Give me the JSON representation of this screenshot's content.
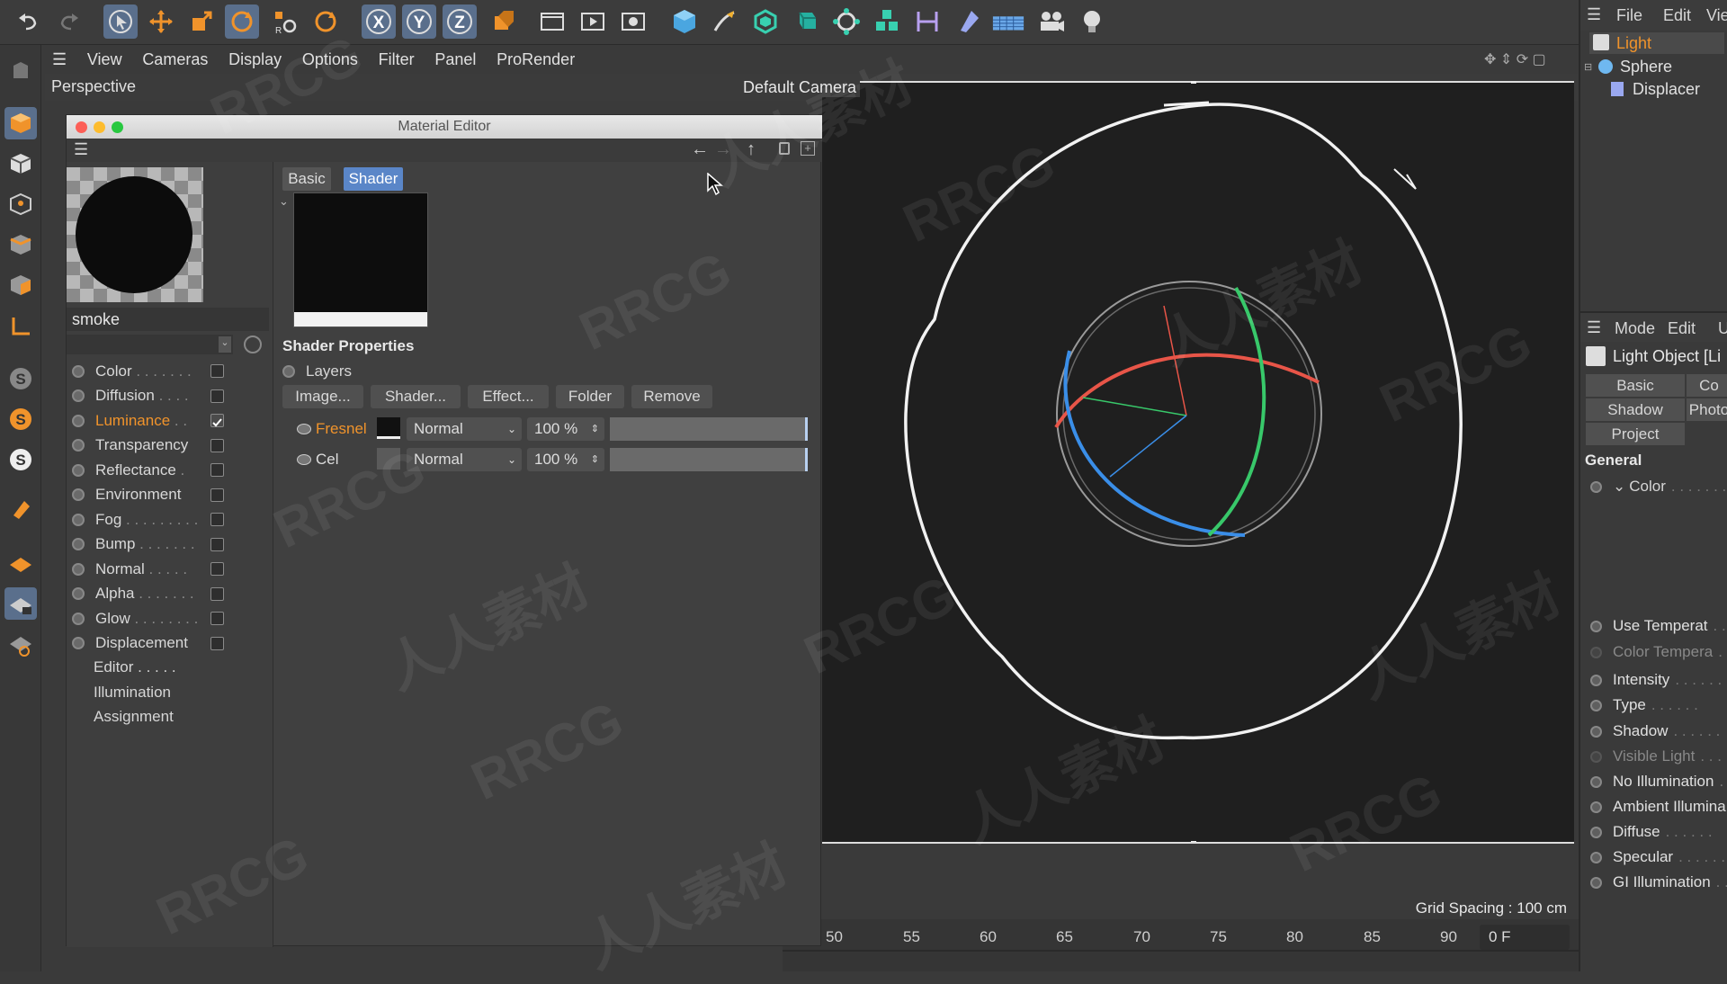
{
  "menubar": {
    "items": [
      "View",
      "Cameras",
      "Display",
      "Options",
      "Filter",
      "Panel",
      "ProRender"
    ]
  },
  "viewport": {
    "name": "Perspective",
    "camera": "Default Camera",
    "grid_spacing": "Grid Spacing : 100 cm"
  },
  "toolbar": {
    "icons": [
      "undo-icon",
      "redo-icon",
      "select-icon",
      "move-icon",
      "scale-icon",
      "rotate-icon",
      "recent-tool-icon",
      "rotate-tool-icon",
      "x-axis-icon",
      "y-axis-icon",
      "z-axis-icon",
      "coordinate-system-icon",
      "render-region-icon",
      "render-view-icon",
      "render-settings-icon",
      "cube-icon",
      "pen-icon",
      "subdivision-icon",
      "array-icon",
      "mograph-icon",
      "cloner-icon",
      "deformer-icon",
      "field-icon",
      "floor-icon",
      "camera-icon",
      "light-icon"
    ],
    "axis_labels": [
      "X",
      "Y",
      "Z"
    ]
  },
  "material_editor": {
    "title": "Material Editor",
    "material_name": "smoke",
    "tabs": [
      "Basic",
      "Shader"
    ],
    "active_tab": "Shader",
    "channels": [
      {
        "label": "Color",
        "dots": ". . . . . . .",
        "checked": false,
        "active": false
      },
      {
        "label": "Diffusion",
        "dots": ". . . .",
        "checked": false,
        "active": false
      },
      {
        "label": "Luminance",
        "dots": ". .",
        "checked": true,
        "active": true
      },
      {
        "label": "Transparency",
        "dots": "",
        "checked": false,
        "active": false
      },
      {
        "label": "Reflectance",
        "dots": ".",
        "checked": false,
        "active": false
      },
      {
        "label": "Environment",
        "dots": "",
        "checked": false,
        "active": false
      },
      {
        "label": "Fog",
        "dots": ". . . . . . . . .",
        "checked": false,
        "active": false
      },
      {
        "label": "Bump",
        "dots": ". . . . . . .",
        "checked": false,
        "active": false
      },
      {
        "label": "Normal",
        "dots": ". . . . .",
        "checked": false,
        "active": false
      },
      {
        "label": "Alpha",
        "dots": ". . . . . . .",
        "checked": false,
        "active": false
      },
      {
        "label": "Glow",
        "dots": ". . . . . . . .",
        "checked": false,
        "active": false
      },
      {
        "label": "Displacement",
        "dots": "",
        "checked": false,
        "active": false
      }
    ],
    "extra_items": [
      "Editor . . . . .",
      "Illumination",
      "Assignment"
    ],
    "shader_properties_title": "Shader Properties",
    "layers_label": "Layers",
    "buttons": [
      "Image...",
      "Shader...",
      "Effect...",
      "Folder",
      "Remove"
    ],
    "layers": [
      {
        "name": "Fresnel",
        "blend": "Normal",
        "opacity": "100 %",
        "opacity_fraction": 1.0,
        "active": true
      },
      {
        "name": "Cel",
        "blend": "Normal",
        "opacity": "100 %",
        "opacity_fraction": 1.0,
        "active": false
      }
    ]
  },
  "object_manager": {
    "menu": [
      "File",
      "Edit",
      "View"
    ],
    "objects": [
      {
        "name": "Light",
        "selected": true
      },
      {
        "name": "Sphere",
        "selected": false
      },
      {
        "name": "Displacer",
        "selected": false
      }
    ]
  },
  "attribute_manager": {
    "menu": [
      "Mode",
      "Edit",
      "U"
    ],
    "title": "Light Object [Li",
    "tabs": [
      "Basic",
      "Co",
      "Shadow",
      "Photo",
      "Project"
    ],
    "section": "General",
    "color_label": "Color",
    "params": [
      {
        "label": "Use Temperat",
        "enabled": true
      },
      {
        "label": "Color Tempera",
        "enabled": false
      },
      {
        "label": "Intensity",
        "enabled": true
      },
      {
        "label": "Type",
        "enabled": true
      },
      {
        "label": "Shadow",
        "enabled": true
      },
      {
        "label": "Visible Light",
        "enabled": false
      },
      {
        "label": "No Illumination",
        "enabled": true
      },
      {
        "label": "Ambient Illumina",
        "enabled": true
      },
      {
        "label": "Diffuse",
        "enabled": true
      },
      {
        "label": "Specular",
        "enabled": true
      },
      {
        "label": "GI Illumination",
        "enabled": true
      }
    ]
  },
  "timeline": {
    "ticks": [
      "50",
      "55",
      "60",
      "65",
      "70",
      "75",
      "80",
      "85",
      "90"
    ],
    "current_frame": "0 F"
  },
  "watermarks": [
    "RRCG",
    "人人素材"
  ],
  "colors": {
    "accent_orange": "#f0932b",
    "selection_blue": "#5a6f8c",
    "viewport_bg": "#1f1f1f"
  }
}
